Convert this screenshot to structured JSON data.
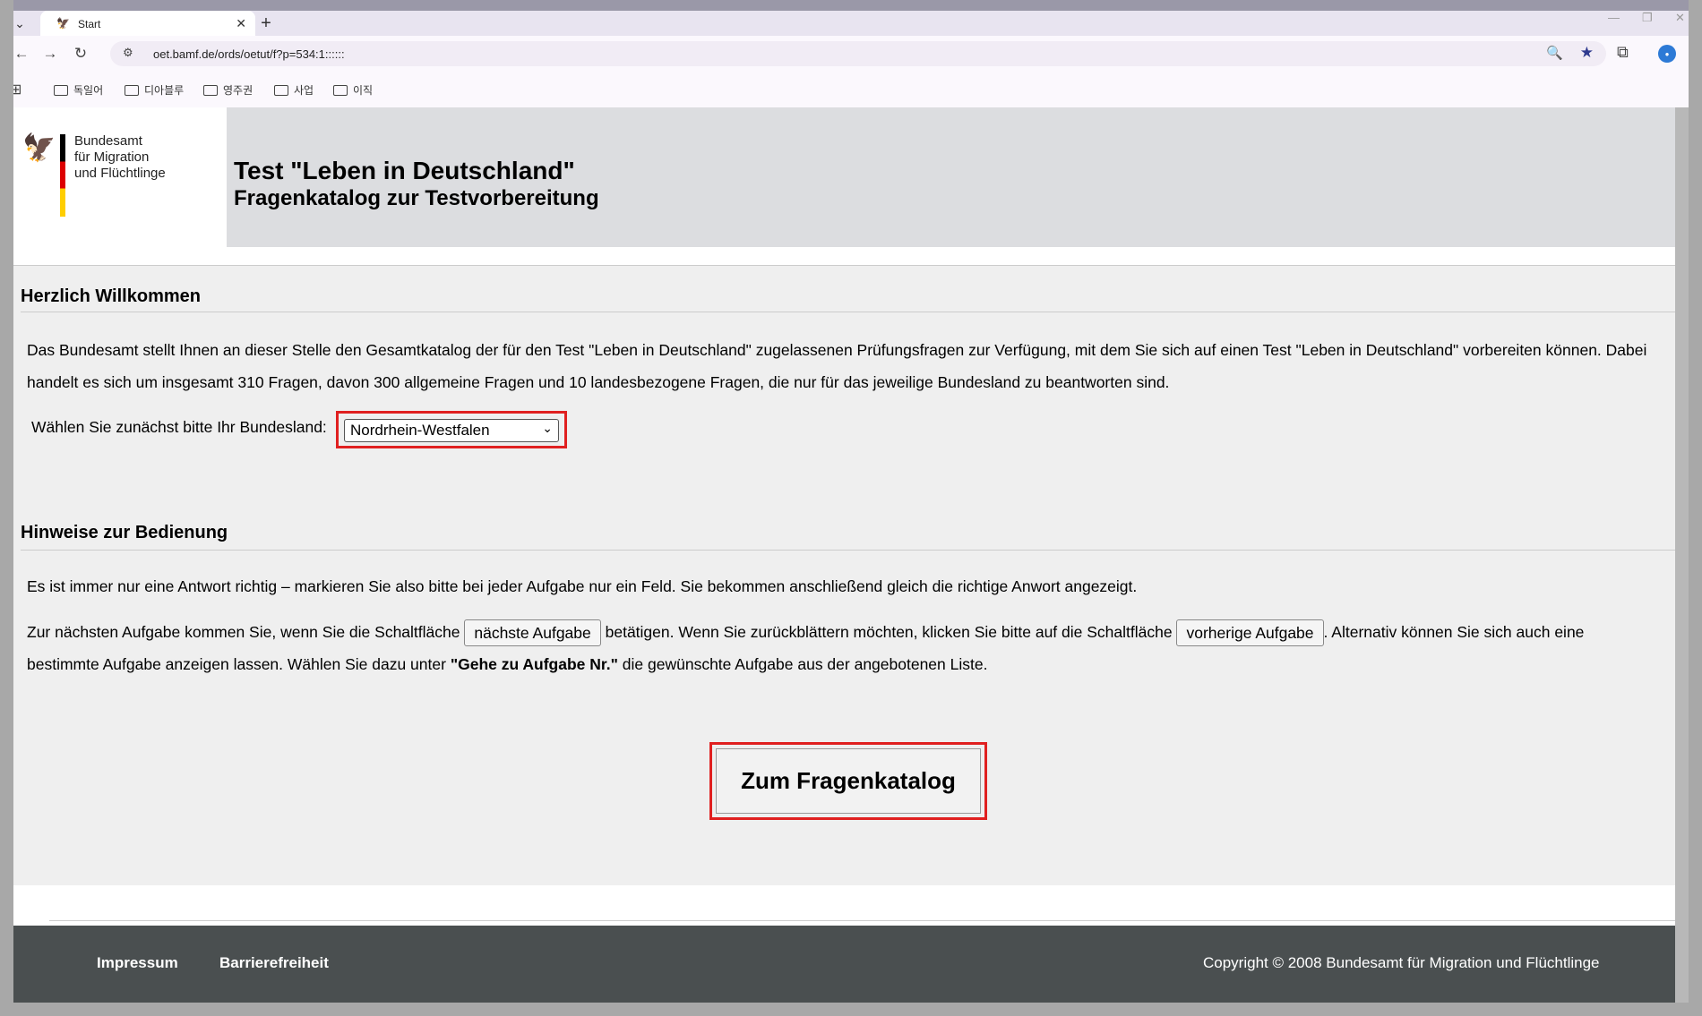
{
  "browser": {
    "tab_title": "Start",
    "url": "oet.bamf.de/ords/oetut/f?p=534:1::::::",
    "bookmarks": [
      "독일어",
      "디아블루",
      "영주권",
      "사업",
      "이직"
    ]
  },
  "header": {
    "logo_lines": [
      "Bundesamt",
      "für Migration",
      "und Flüchtlinge"
    ],
    "title": "Test \"Leben in Deutschland\"",
    "subtitle": "Fragenkatalog zur Testvorbereitung"
  },
  "welcome": {
    "heading": "Herzlich Willkommen",
    "intro_line1": "Das Bundesamt stellt Ihnen an dieser Stelle den Gesamtkatalog der für den Test \"Leben in Deutschland\" zugelassenen Prüfungsfragen zur Verfügung, mit dem Sie sich auf einen Test \"Leben in Deutschland\" vorbereiten können. Dabei",
    "intro_line2": "handelt es sich um insgesamt 310 Fragen, davon 300 allgemeine Fragen und 10 landesbezogene Fragen, die nur für das jeweilige Bundesland zu beantworten sind.",
    "select_label": "Wählen Sie zunächst bitte Ihr Bundesland:",
    "selected_state": "Nordrhein-Westfalen"
  },
  "hints": {
    "heading": "Hinweise zur Bedienung",
    "p1": "Es ist immer nur eine Antwort richtig – markieren Sie also bitte bei jeder Aufgabe nur ein Feld. Sie bekommen anschließend gleich die richtige Anwort angezeigt.",
    "p2_a": "Zur nächsten Aufgabe kommen Sie, wenn Sie die Schaltfläche",
    "btn_next": "nächste Aufgabe",
    "p2_b": "betätigen. Wenn Sie zurückblättern möchten, klicken Sie bitte auf die Schaltfläche",
    "btn_prev": "vorherige Aufgabe",
    "p2_c": ". Alternativ können Sie sich auch eine",
    "p3_a": "bestimmte Aufgabe anzeigen lassen. Wählen Sie dazu unter",
    "p3_bold": "\"Gehe zu Aufgabe Nr.\"",
    "p3_b": "die gewünschte Aufgabe aus der angebotenen Liste."
  },
  "cta": {
    "label": "Zum Fragenkatalog"
  },
  "footer": {
    "impressum": "Impressum",
    "barrierefreiheit": "Barrierefreiheit",
    "copyright": "Copyright © 2008 Bundesamt für Migration und Flüchtlinge"
  },
  "colors": {
    "highlight": "#e02020",
    "footer_bg": "#4a4f50",
    "header_band": "#dcdde0"
  }
}
